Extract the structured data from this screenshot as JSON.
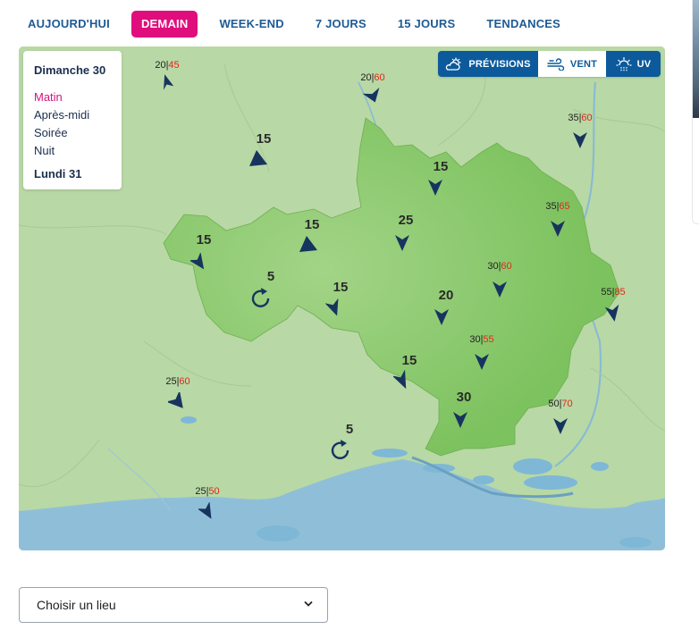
{
  "tabs": [
    {
      "label": "AUJOURD'HUI",
      "active": false
    },
    {
      "label": "DEMAIN",
      "active": true
    },
    {
      "label": "WEEK-END",
      "active": false
    },
    {
      "label": "7 JOURS",
      "active": false
    },
    {
      "label": "15 JOURS",
      "active": false
    },
    {
      "label": "TENDANCES",
      "active": false
    }
  ],
  "day_panel": {
    "day1": "Dimanche 30",
    "periods": [
      "Matin",
      "Après-midi",
      "Soirée",
      "Nuit"
    ],
    "selected_period": "Matin",
    "day2": "Lundi 31"
  },
  "layers": {
    "previsions": "PRÉVISIONS",
    "vent": "VENT",
    "uv": "UV",
    "active": "VENT"
  },
  "wind": {
    "inland_labels": [
      "15",
      "15",
      "15",
      "25",
      "15",
      "5",
      "15",
      "20",
      "15",
      "30",
      "5"
    ],
    "coast_pairs": [
      {
        "wind": "20",
        "gust": "45"
      },
      {
        "wind": "20",
        "gust": "60"
      },
      {
        "wind": "35",
        "gust": "60"
      },
      {
        "wind": "35",
        "gust": "65"
      },
      {
        "wind": "30",
        "gust": "60"
      },
      {
        "wind": "55",
        "gust": "85"
      },
      {
        "wind": "30",
        "gust": "55"
      },
      {
        "wind": "25",
        "gust": "60"
      },
      {
        "wind": "50",
        "gust": "70"
      },
      {
        "wind": "25",
        "gust": "50"
      }
    ]
  },
  "place_select": {
    "label": "Choisir un lieu"
  },
  "colors": {
    "accent_pink": "#e00d7d",
    "nav_blue": "#1e5a94",
    "switch_blue": "#0c5a9b",
    "gust_red": "#e0281c",
    "region_green": "#8cc96b",
    "sea_blue": "#8fbfd8"
  }
}
